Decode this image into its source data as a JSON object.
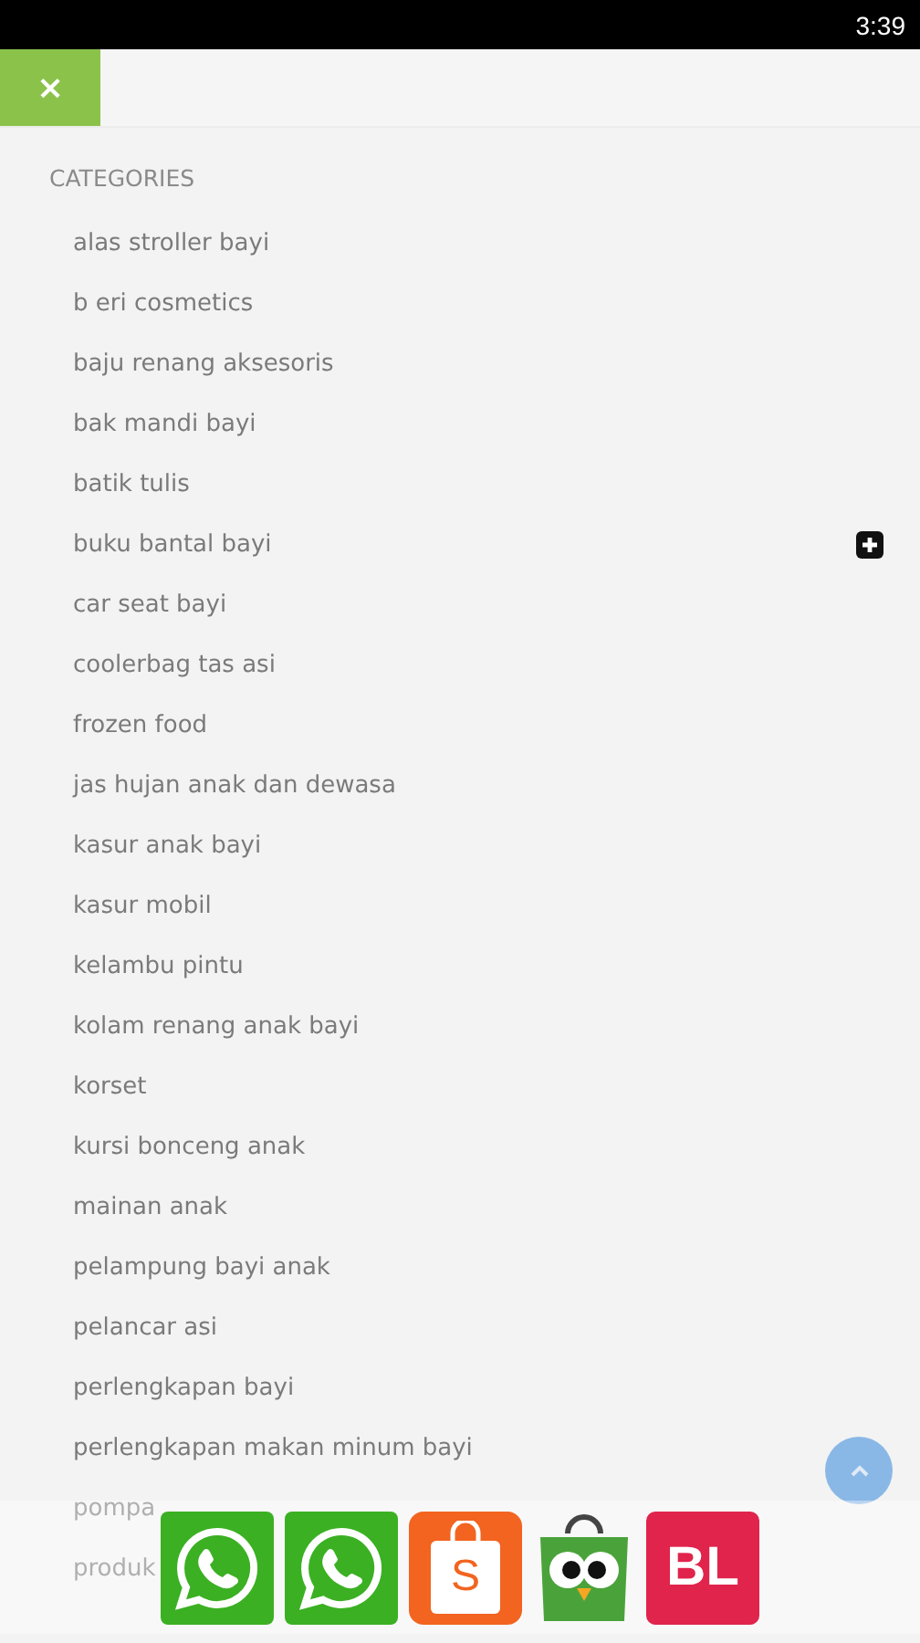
{
  "status_bar": {
    "time": "3:39"
  },
  "close_button": {
    "label": "×"
  },
  "section_title": "CATEGORIES",
  "categories": [
    {
      "label": "alas stroller bayi",
      "expandable": false
    },
    {
      "label": "b eri cosmetics",
      "expandable": false
    },
    {
      "label": "baju renang aksesoris",
      "expandable": false
    },
    {
      "label": "bak mandi bayi",
      "expandable": false
    },
    {
      "label": "batik tulis",
      "expandable": false
    },
    {
      "label": "buku bantal bayi",
      "expandable": true
    },
    {
      "label": "car seat bayi",
      "expandable": false
    },
    {
      "label": "coolerbag tas asi",
      "expandable": false
    },
    {
      "label": "frozen food",
      "expandable": false
    },
    {
      "label": "jas hujan anak dan dewasa",
      "expandable": false
    },
    {
      "label": "kasur anak bayi",
      "expandable": false
    },
    {
      "label": "kasur mobil",
      "expandable": false
    },
    {
      "label": "kelambu pintu",
      "expandable": false
    },
    {
      "label": "kolam renang anak bayi",
      "expandable": false
    },
    {
      "label": "korset",
      "expandable": false
    },
    {
      "label": "kursi bonceng anak",
      "expandable": false
    },
    {
      "label": "mainan anak",
      "expandable": false
    },
    {
      "label": "pelampung bayi anak",
      "expandable": false
    },
    {
      "label": "pelancar asi",
      "expandable": false
    },
    {
      "label": "perlengkapan bayi",
      "expandable": false
    },
    {
      "label": "perlengkapan makan minum bayi",
      "expandable": false
    },
    {
      "label": "pompa",
      "expandable": false
    },
    {
      "label": "produk",
      "expandable": false
    }
  ],
  "shop_links": [
    {
      "kind": "whatsapp"
    },
    {
      "kind": "whatsapp"
    },
    {
      "kind": "shopee",
      "label": "S"
    },
    {
      "kind": "tokopedia"
    },
    {
      "kind": "bukalapak",
      "label": "BL"
    }
  ]
}
